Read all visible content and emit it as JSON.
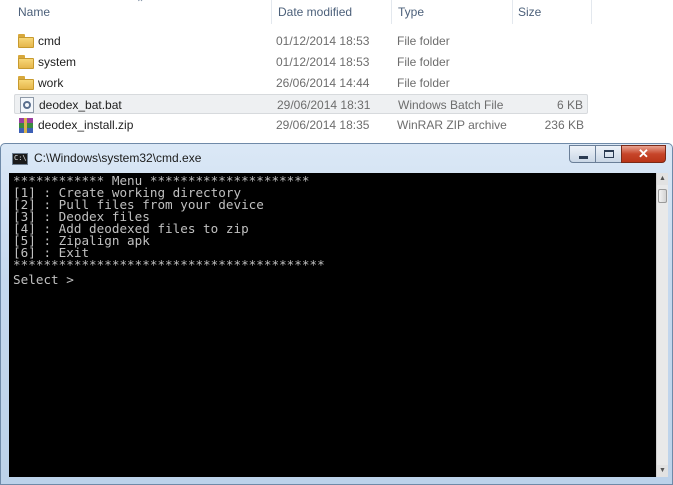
{
  "explorer": {
    "columns": {
      "name": "Name",
      "date": "Date modified",
      "type": "Type",
      "size": "Size"
    },
    "files": [
      {
        "name": "cmd",
        "date": "01/12/2014 18:53",
        "type": "File folder",
        "size": "",
        "icon": "folder-icon"
      },
      {
        "name": "system",
        "date": "01/12/2014 18:53",
        "type": "File folder",
        "size": "",
        "icon": "folder-icon"
      },
      {
        "name": "work",
        "date": "26/06/2014 14:44",
        "type": "File folder",
        "size": "",
        "icon": "folder-icon"
      },
      {
        "name": "deodex_bat.bat",
        "date": "29/06/2014 18:31",
        "type": "Windows Batch File",
        "size": "6 KB",
        "icon": "batch-file-icon"
      },
      {
        "name": "deodex_install.zip",
        "date": "29/06/2014 18:35",
        "type": "WinRAR ZIP archive",
        "size": "236 KB",
        "icon": "winrar-archive-icon"
      }
    ]
  },
  "cmd": {
    "title": "C:\\Windows\\system32\\cmd.exe",
    "icon_label": "C:\\",
    "console_lines": [
      "************ Menu *********************",
      "[1] : Create working directory",
      "[2] : Pull files from your device",
      "[3] : Deodex files",
      "[4] : Add deodexed files to zip",
      "[5] : Zipalign apk",
      "[6] : Exit",
      "*****************************************"
    ],
    "prompt": "Select >",
    "close_glyph": "✕"
  }
}
